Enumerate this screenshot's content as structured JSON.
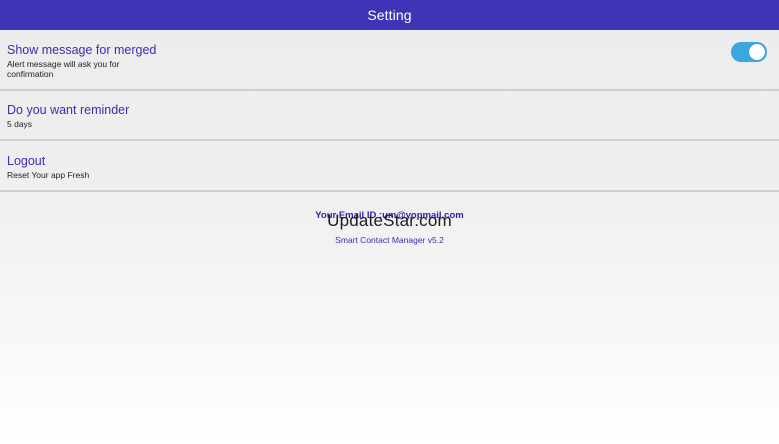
{
  "header": {
    "title": "Setting",
    "background": "#3f33b6"
  },
  "settings": [
    {
      "title": "Show message for merged",
      "subtitle": "Alert message will ask you for\n confirmation",
      "toggle_on": true,
      "toggle_color": "#3ca7de"
    },
    {
      "title": "Do you want reminder",
      "subtitle": "5 days"
    },
    {
      "title": "Logout",
      "subtitle": "Reset Your app Fresh"
    }
  ],
  "footer": {
    "email_line": "Your Email ID :um@yopmail.com",
    "watermark": "UpdateStar.com",
    "version": "Smart Contact Manager v5.2"
  },
  "colors": {
    "title_text": "#3a2eb0",
    "divider": "#cfcfcf"
  }
}
